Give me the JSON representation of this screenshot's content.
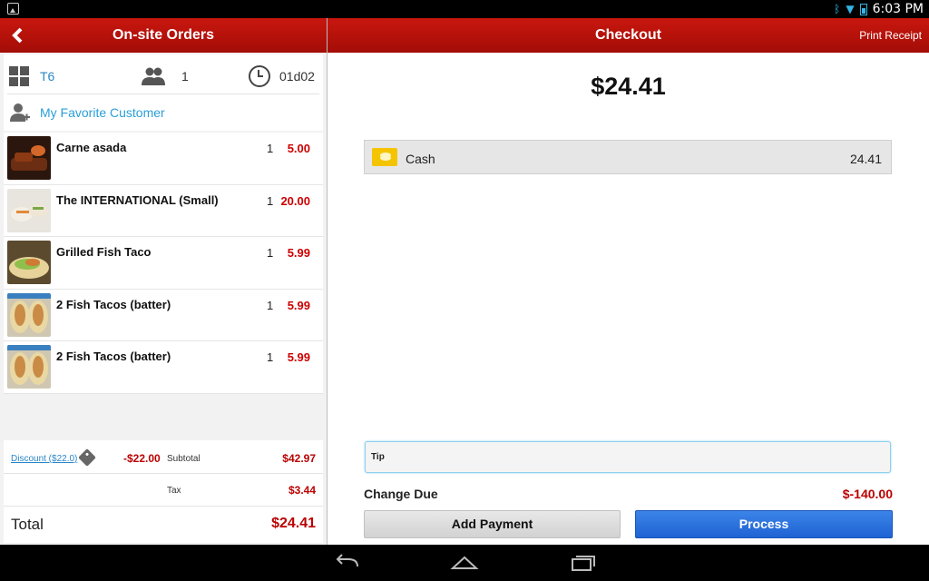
{
  "status_bar": {
    "time": "6:03 PM"
  },
  "header": {
    "left_title": "On-site Orders",
    "right_title": "Checkout",
    "print_label": "Print Receipt"
  },
  "order_info": {
    "table": "T6",
    "guests": "1",
    "time_code": "01d02",
    "customer": "My Favorite Customer"
  },
  "items": [
    {
      "name": "Carne asada",
      "qty": "1",
      "price": "5.00"
    },
    {
      "name": "The INTERNATIONAL (Small)",
      "qty": "1",
      "price": "20.00"
    },
    {
      "name": "Grilled Fish Taco",
      "qty": "1",
      "price": "5.99"
    },
    {
      "name": "2 Fish Tacos (batter)",
      "qty": "1",
      "price": "5.99"
    },
    {
      "name": "2 Fish Tacos (batter)",
      "qty": "1",
      "price": "5.99"
    }
  ],
  "totals": {
    "discount_label": "Discount ($22.0)",
    "discount_value": "-$22.00",
    "subtotal_label": "Subtotal",
    "subtotal_value": "$42.97",
    "tax_label": "Tax",
    "tax_value": "$3.44",
    "total_label": "Total",
    "total_value": "$24.41"
  },
  "checkout": {
    "amount": "$24.41",
    "payment": {
      "method": "Cash",
      "amount": "24.41"
    },
    "tip_placeholder": "Tip",
    "change_label": "Change Due",
    "change_value": "$-140.00",
    "add_payment_label": "Add Payment",
    "process_label": "Process"
  },
  "colors": {
    "header": "#b5120a",
    "price": "#c00000",
    "link": "#2a86c8",
    "process": "#2a6fe0"
  },
  "icons": {
    "back": "chevron-left-icon",
    "table": "grid-icon",
    "guests": "people-icon",
    "time": "clock-icon",
    "customer": "add-person-icon",
    "discount": "tag-icon",
    "payment": "cash-icon"
  }
}
